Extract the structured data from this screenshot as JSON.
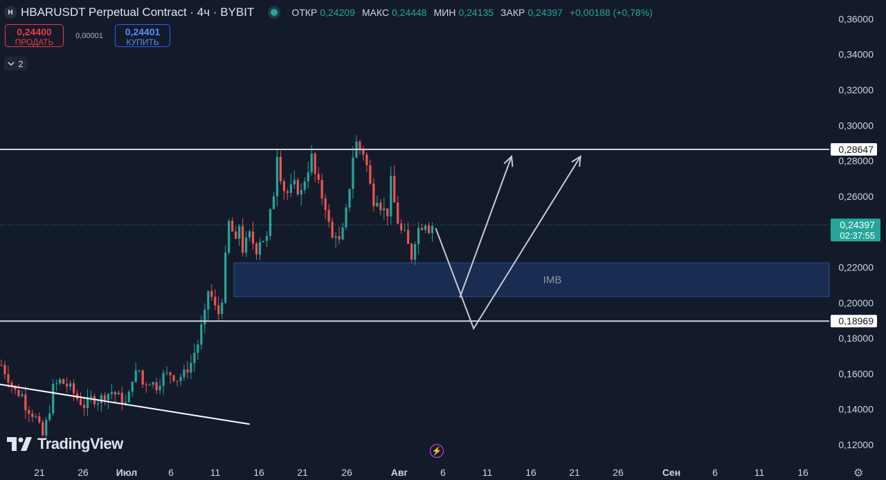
{
  "header": {
    "symbol_logo": "H",
    "title": "HBARUSDT Perpetual Contract · 4ч · BYBIT",
    "ohlc": [
      {
        "label": "ОТКР",
        "value": "0,24209"
      },
      {
        "label": "МАКС",
        "value": "0,24448"
      },
      {
        "label": "МИН",
        "value": "0,24135"
      },
      {
        "label": "ЗАКР",
        "value": "0,24397"
      }
    ],
    "change": "+0,00188 (+0,78%)"
  },
  "trade": {
    "sell_price": "0,24400",
    "sell_label": "ПРОДАТЬ",
    "spread": "0,00001",
    "buy_price": "0,24401",
    "buy_label": "КУПИТЬ"
  },
  "collapse": {
    "icon": "chevron-down-icon",
    "count": "2"
  },
  "logo": {
    "text": "TradingView"
  },
  "colors": {
    "background": "#131b2b",
    "up": "#26a69a",
    "down": "#ef5350",
    "zone": "#1f3a73",
    "level_line": "#d1d4dc",
    "projection": "#c8cbd4"
  },
  "chart_data": {
    "type": "candlestick",
    "title": "HBARUSDT Perpetual Contract · 4ч · BYBIT",
    "ylim": [
      0.1155,
      0.3665
    ],
    "y_ticks": [
      "0,12000",
      "0,14000",
      "0,16000",
      "0,18000",
      "0,20000",
      "0,22000",
      "0,24000",
      "0,26000",
      "0,28000",
      "0,30000",
      "0,32000",
      "0,34000",
      "0,36000"
    ],
    "x_ticks": [
      "21",
      "26",
      "Июл",
      "6",
      "11",
      "16",
      "21",
      "26",
      "Авг",
      "6",
      "11",
      "16",
      "21",
      "26",
      "Сен",
      "6",
      "11",
      "16"
    ],
    "grid": false,
    "path": [
      [
        0,
        0.165
      ],
      [
        4,
        0.15
      ],
      [
        6,
        0.148
      ],
      [
        7,
        0.142
      ],
      [
        10,
        0.135
      ],
      [
        12,
        0.125
      ],
      [
        14,
        0.14
      ],
      [
        15,
        0.152
      ],
      [
        17,
        0.156
      ],
      [
        20,
        0.152
      ],
      [
        22,
        0.146
      ],
      [
        24,
        0.142
      ],
      [
        26,
        0.146
      ],
      [
        28,
        0.145
      ],
      [
        30,
        0.148
      ],
      [
        32,
        0.15
      ],
      [
        34,
        0.147
      ],
      [
        36,
        0.143
      ],
      [
        37,
        0.148
      ],
      [
        38,
        0.158
      ],
      [
        40,
        0.162
      ],
      [
        41,
        0.154
      ],
      [
        43,
        0.156
      ],
      [
        45,
        0.153
      ],
      [
        47,
        0.159
      ],
      [
        49,
        0.16
      ],
      [
        51,
        0.157
      ],
      [
        53,
        0.16
      ],
      [
        55,
        0.166
      ],
      [
        56,
        0.172
      ],
      [
        57,
        0.177
      ],
      [
        58,
        0.186
      ],
      [
        59,
        0.193
      ],
      [
        60,
        0.207
      ],
      [
        61,
        0.203
      ],
      [
        62,
        0.197
      ],
      [
        63,
        0.194
      ],
      [
        64,
        0.203
      ],
      [
        65,
        0.225
      ],
      [
        66,
        0.245
      ],
      [
        67,
        0.24
      ],
      [
        68,
        0.233
      ],
      [
        69,
        0.244
      ],
      [
        70,
        0.23
      ],
      [
        72,
        0.238
      ],
      [
        74,
        0.23
      ],
      [
        75,
        0.236
      ],
      [
        77,
        0.236
      ],
      [
        78,
        0.25
      ],
      [
        79,
        0.262
      ],
      [
        80,
        0.285
      ],
      [
        81,
        0.272
      ],
      [
        82,
        0.264
      ],
      [
        83,
        0.262
      ],
      [
        85,
        0.266
      ],
      [
        87,
        0.262
      ],
      [
        88,
        0.27
      ],
      [
        89,
        0.276
      ],
      [
        90,
        0.282
      ],
      [
        91,
        0.272
      ],
      [
        92,
        0.266
      ],
      [
        93,
        0.26
      ],
      [
        94,
        0.255
      ],
      [
        95,
        0.244
      ],
      [
        96,
        0.236
      ],
      [
        97,
        0.24
      ],
      [
        98,
        0.234
      ],
      [
        99,
        0.24
      ],
      [
        100,
        0.251
      ],
      [
        101,
        0.266
      ],
      [
        102,
        0.283
      ],
      [
        103,
        0.29
      ],
      [
        104,
        0.287
      ],
      [
        105,
        0.285
      ],
      [
        106,
        0.277
      ],
      [
        107,
        0.266
      ],
      [
        108,
        0.258
      ],
      [
        109,
        0.26
      ],
      [
        110,
        0.255
      ],
      [
        111,
        0.252
      ],
      [
        112,
        0.251
      ],
      [
        113,
        0.268
      ],
      [
        114,
        0.256
      ],
      [
        115,
        0.246
      ],
      [
        116,
        0.24
      ],
      [
        117,
        0.238
      ],
      [
        118,
        0.232
      ],
      [
        119,
        0.226
      ],
      [
        120,
        0.236
      ],
      [
        121,
        0.242
      ],
      [
        122,
        0.244
      ],
      [
        123,
        0.246
      ],
      [
        124,
        0.242
      ],
      [
        125,
        0.24397
      ]
    ],
    "candle_count": 126,
    "levels": [
      {
        "label": "0,28647",
        "value": 0.28647
      },
      {
        "label": "0,18969",
        "value": 0.18969
      }
    ],
    "current_price": {
      "label": "0,24397",
      "countdown": "02:37:55",
      "value": 0.24397
    },
    "zone": {
      "label": "IMB",
      "y_low": 0.2035,
      "y_high": 0.2225
    },
    "trendline": [
      [
        -2,
        0.1545
      ],
      [
        72,
        0.1316
      ]
    ],
    "projections": [
      [
        [
          126,
          0.242
        ],
        [
          137,
          0.1855
        ],
        [
          168,
          0.2825
        ]
      ],
      [
        [
          133,
          0.203
        ],
        [
          148,
          0.2825
        ]
      ]
    ]
  }
}
